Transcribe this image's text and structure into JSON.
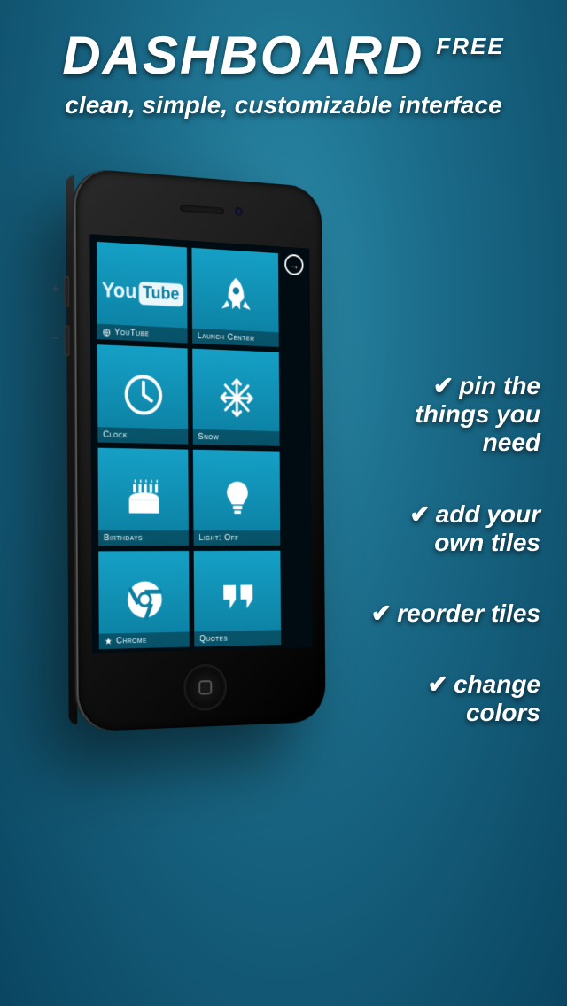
{
  "header": {
    "title": "DASHBOARD",
    "badge": "FREE",
    "subtitle": "clean, simple, customizable interface"
  },
  "phone": {
    "next_arrow": "→",
    "tiles": [
      {
        "label": "YouTube",
        "icon": "youtube-icon",
        "badge": "globe"
      },
      {
        "label": "Launch Center",
        "icon": "rocket-icon"
      },
      {
        "label": "Clock",
        "icon": "clock-icon"
      },
      {
        "label": "Snow",
        "icon": "snowflake-icon"
      },
      {
        "label": "Birthdays",
        "icon": "cake-icon"
      },
      {
        "label": "Light: off",
        "icon": "bulb-icon"
      },
      {
        "label": "Chrome",
        "icon": "chrome-icon",
        "badge": "app"
      },
      {
        "label": "Quotes",
        "icon": "quote-icon"
      }
    ]
  },
  "features": [
    "pin the things you need",
    "add your own tiles",
    "reorder tiles",
    "change colors"
  ],
  "check_glyph": "✔"
}
